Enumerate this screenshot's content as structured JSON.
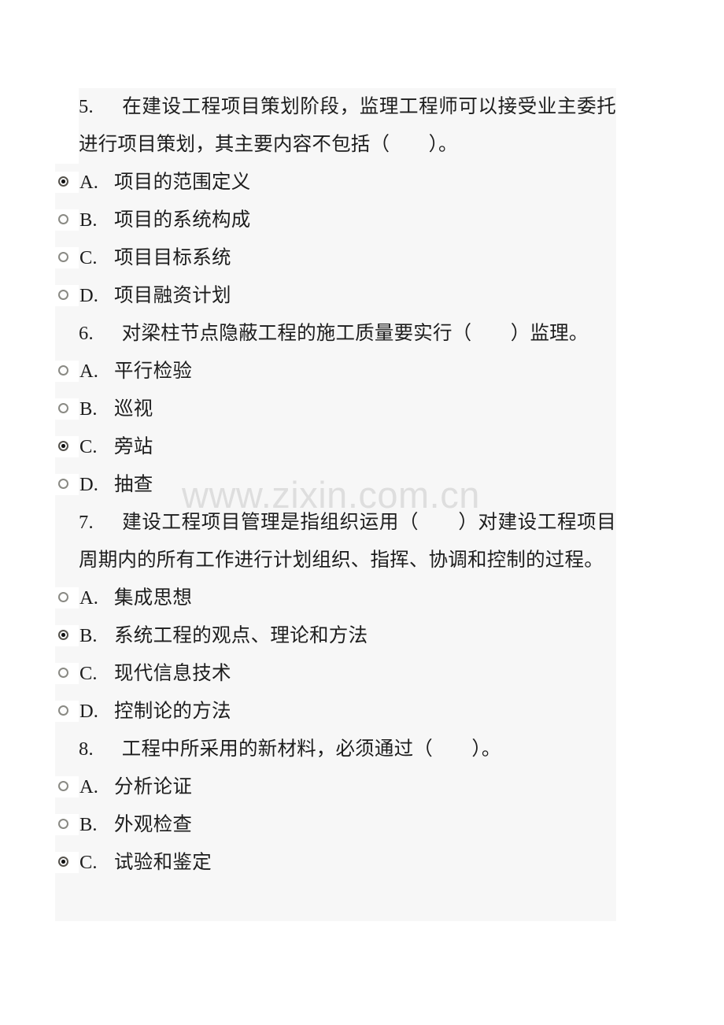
{
  "document": {
    "watermark": "www.zixin.com.cn",
    "background_color": "#ffffff",
    "content_block_color": "#f7f7f7",
    "text_color": "#1d1d1d",
    "watermark_color": "#dedede"
  },
  "questions": [
    {
      "number": "5.",
      "stem": "在建设工程项目策划阶段，监理工程师可以接受业主委托进行项目策划，其主要内容不包括（　　）。",
      "options": [
        {
          "letter": "A.",
          "text": "项目的范围定义",
          "selected": true
        },
        {
          "letter": "B.",
          "text": "项目的系统构成",
          "selected": false
        },
        {
          "letter": "C.",
          "text": "项目目标系统",
          "selected": false
        },
        {
          "letter": "D.",
          "text": "项目融资计划",
          "selected": false
        }
      ]
    },
    {
      "number": "6.",
      "stem": "对梁柱节点隐蔽工程的施工质量要实行（　　）监理。",
      "options": [
        {
          "letter": "A.",
          "text": "平行检验",
          "selected": false
        },
        {
          "letter": "B.",
          "text": "巡视",
          "selected": false
        },
        {
          "letter": "C.",
          "text": "旁站",
          "selected": true
        },
        {
          "letter": "D.",
          "text": "抽查",
          "selected": false
        }
      ]
    },
    {
      "number": "7.",
      "stem": "建设工程项目管理是指组织运用（　　）对建设工程项目周期内的所有工作进行计划组织、指挥、协调和控制的过程。",
      "options": [
        {
          "letter": "A.",
          "text": "集成思想",
          "selected": false
        },
        {
          "letter": "B.",
          "text": "系统工程的观点、理论和方法",
          "selected": true
        },
        {
          "letter": "C.",
          "text": "现代信息技术",
          "selected": false
        },
        {
          "letter": "D.",
          "text": "控制论的方法",
          "selected": false
        }
      ]
    },
    {
      "number": "8.",
      "stem": "工程中所采用的新材料，必须通过（　　）。",
      "options": [
        {
          "letter": "A.",
          "text": "分析论证",
          "selected": false
        },
        {
          "letter": "B.",
          "text": "外观检查",
          "selected": false
        },
        {
          "letter": "C.",
          "text": "试验和鉴定",
          "selected": true
        }
      ]
    }
  ]
}
